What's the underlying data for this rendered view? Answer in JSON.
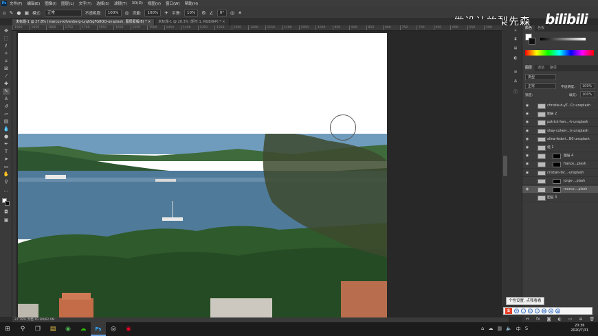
{
  "menubar": {
    "logo": "Ps",
    "items": [
      "文件(F)",
      "编辑(E)",
      "图像(I)",
      "图层(L)",
      "文字(Y)",
      "选择(S)",
      "滤镜(T)",
      "3D(D)",
      "视图(V)",
      "窗口(W)",
      "帮助(H)"
    ]
  },
  "options": {
    "mode_label": "模式:",
    "mode_value": "正常",
    "opacity_label": "不透明度:",
    "opacity_value": "100%",
    "flow_label": "流量:",
    "flow_value": "100%",
    "smooth_label": "平滑:",
    "smooth_value": "10%",
    "angle_value": "0°"
  },
  "watermark": {
    "text": "做设计的梨先森",
    "bili": "bilibili"
  },
  "tabs": [
    {
      "label": "未标题-1 @ 27.8% (marcus-lofvenberg-LyqhSgFG8QQ-unsplash, 图层蒙版/8) * ×",
      "active": true
    },
    {
      "label": "未标题-1 @ 28.3% (矩形 1, RGB/8#) * ×",
      "active": false
    }
  ],
  "ruler": {
    "ticks": [
      "1900",
      "1850",
      "1800",
      "1750",
      "1700",
      "1650",
      "1600",
      "1550",
      "1500",
      "1450",
      "1400",
      "1350",
      "1300",
      "1250",
      "1200",
      "1150",
      "1100",
      "1050",
      "1000",
      "950",
      "900",
      "850",
      "800",
      "750",
      "700",
      "650",
      "600",
      "550",
      "500"
    ]
  },
  "status": {
    "text": "27.78%   文档:10.1M/62.0M"
  },
  "panels": {
    "color_tabs": [
      "颜色",
      "色板"
    ],
    "layer_tabs": [
      "图层",
      "通道",
      "路径"
    ],
    "filter": "类型",
    "blend": "正常",
    "opacity_label": "不透明度:",
    "opacity_value": "100%",
    "lock_label": "锁定:",
    "fill_label": "填充:",
    "fill_value": "100%"
  },
  "layers": [
    {
      "name": "christie-d-yT...Cc-unsplash",
      "visible": true,
      "mask": false,
      "selected": false
    },
    {
      "name": "图层 2",
      "visible": true,
      "mask": false,
      "selected": false
    },
    {
      "name": "patrick-hen...-k-unsplash",
      "visible": true,
      "mask": false,
      "selected": false
    },
    {
      "name": "shay-cohen-...k-unsplash",
      "visible": true,
      "mask": false,
      "selected": false
    },
    {
      "name": "alina-fedori...N0-unsplash",
      "visible": true,
      "mask": false,
      "selected": false
    },
    {
      "name": "组 1",
      "visible": true,
      "mask": false,
      "selected": false
    },
    {
      "name": "图层 4",
      "visible": true,
      "mask": true,
      "selected": false
    },
    {
      "name": "france...plash",
      "visible": true,
      "mask": true,
      "selected": false
    },
    {
      "name": "cristian-far...-unsplash",
      "visible": true,
      "mask": false,
      "selected": false
    },
    {
      "name": "jorge-...plash",
      "visible": false,
      "mask": true,
      "selected": false
    },
    {
      "name": "marcu-...plash",
      "visible": true,
      "mask": true,
      "selected": true
    },
    {
      "name": "图层 3",
      "visible": false,
      "mask": false,
      "selected": false
    }
  ],
  "tooltip": "个性设置, 点我看看",
  "clock": {
    "time": "20:36",
    "date": "2020/7/31"
  },
  "colors": {
    "accent": "#31a8ff",
    "panel_bg": "#3b3b3b",
    "taskbar": "#1b1b1b"
  }
}
